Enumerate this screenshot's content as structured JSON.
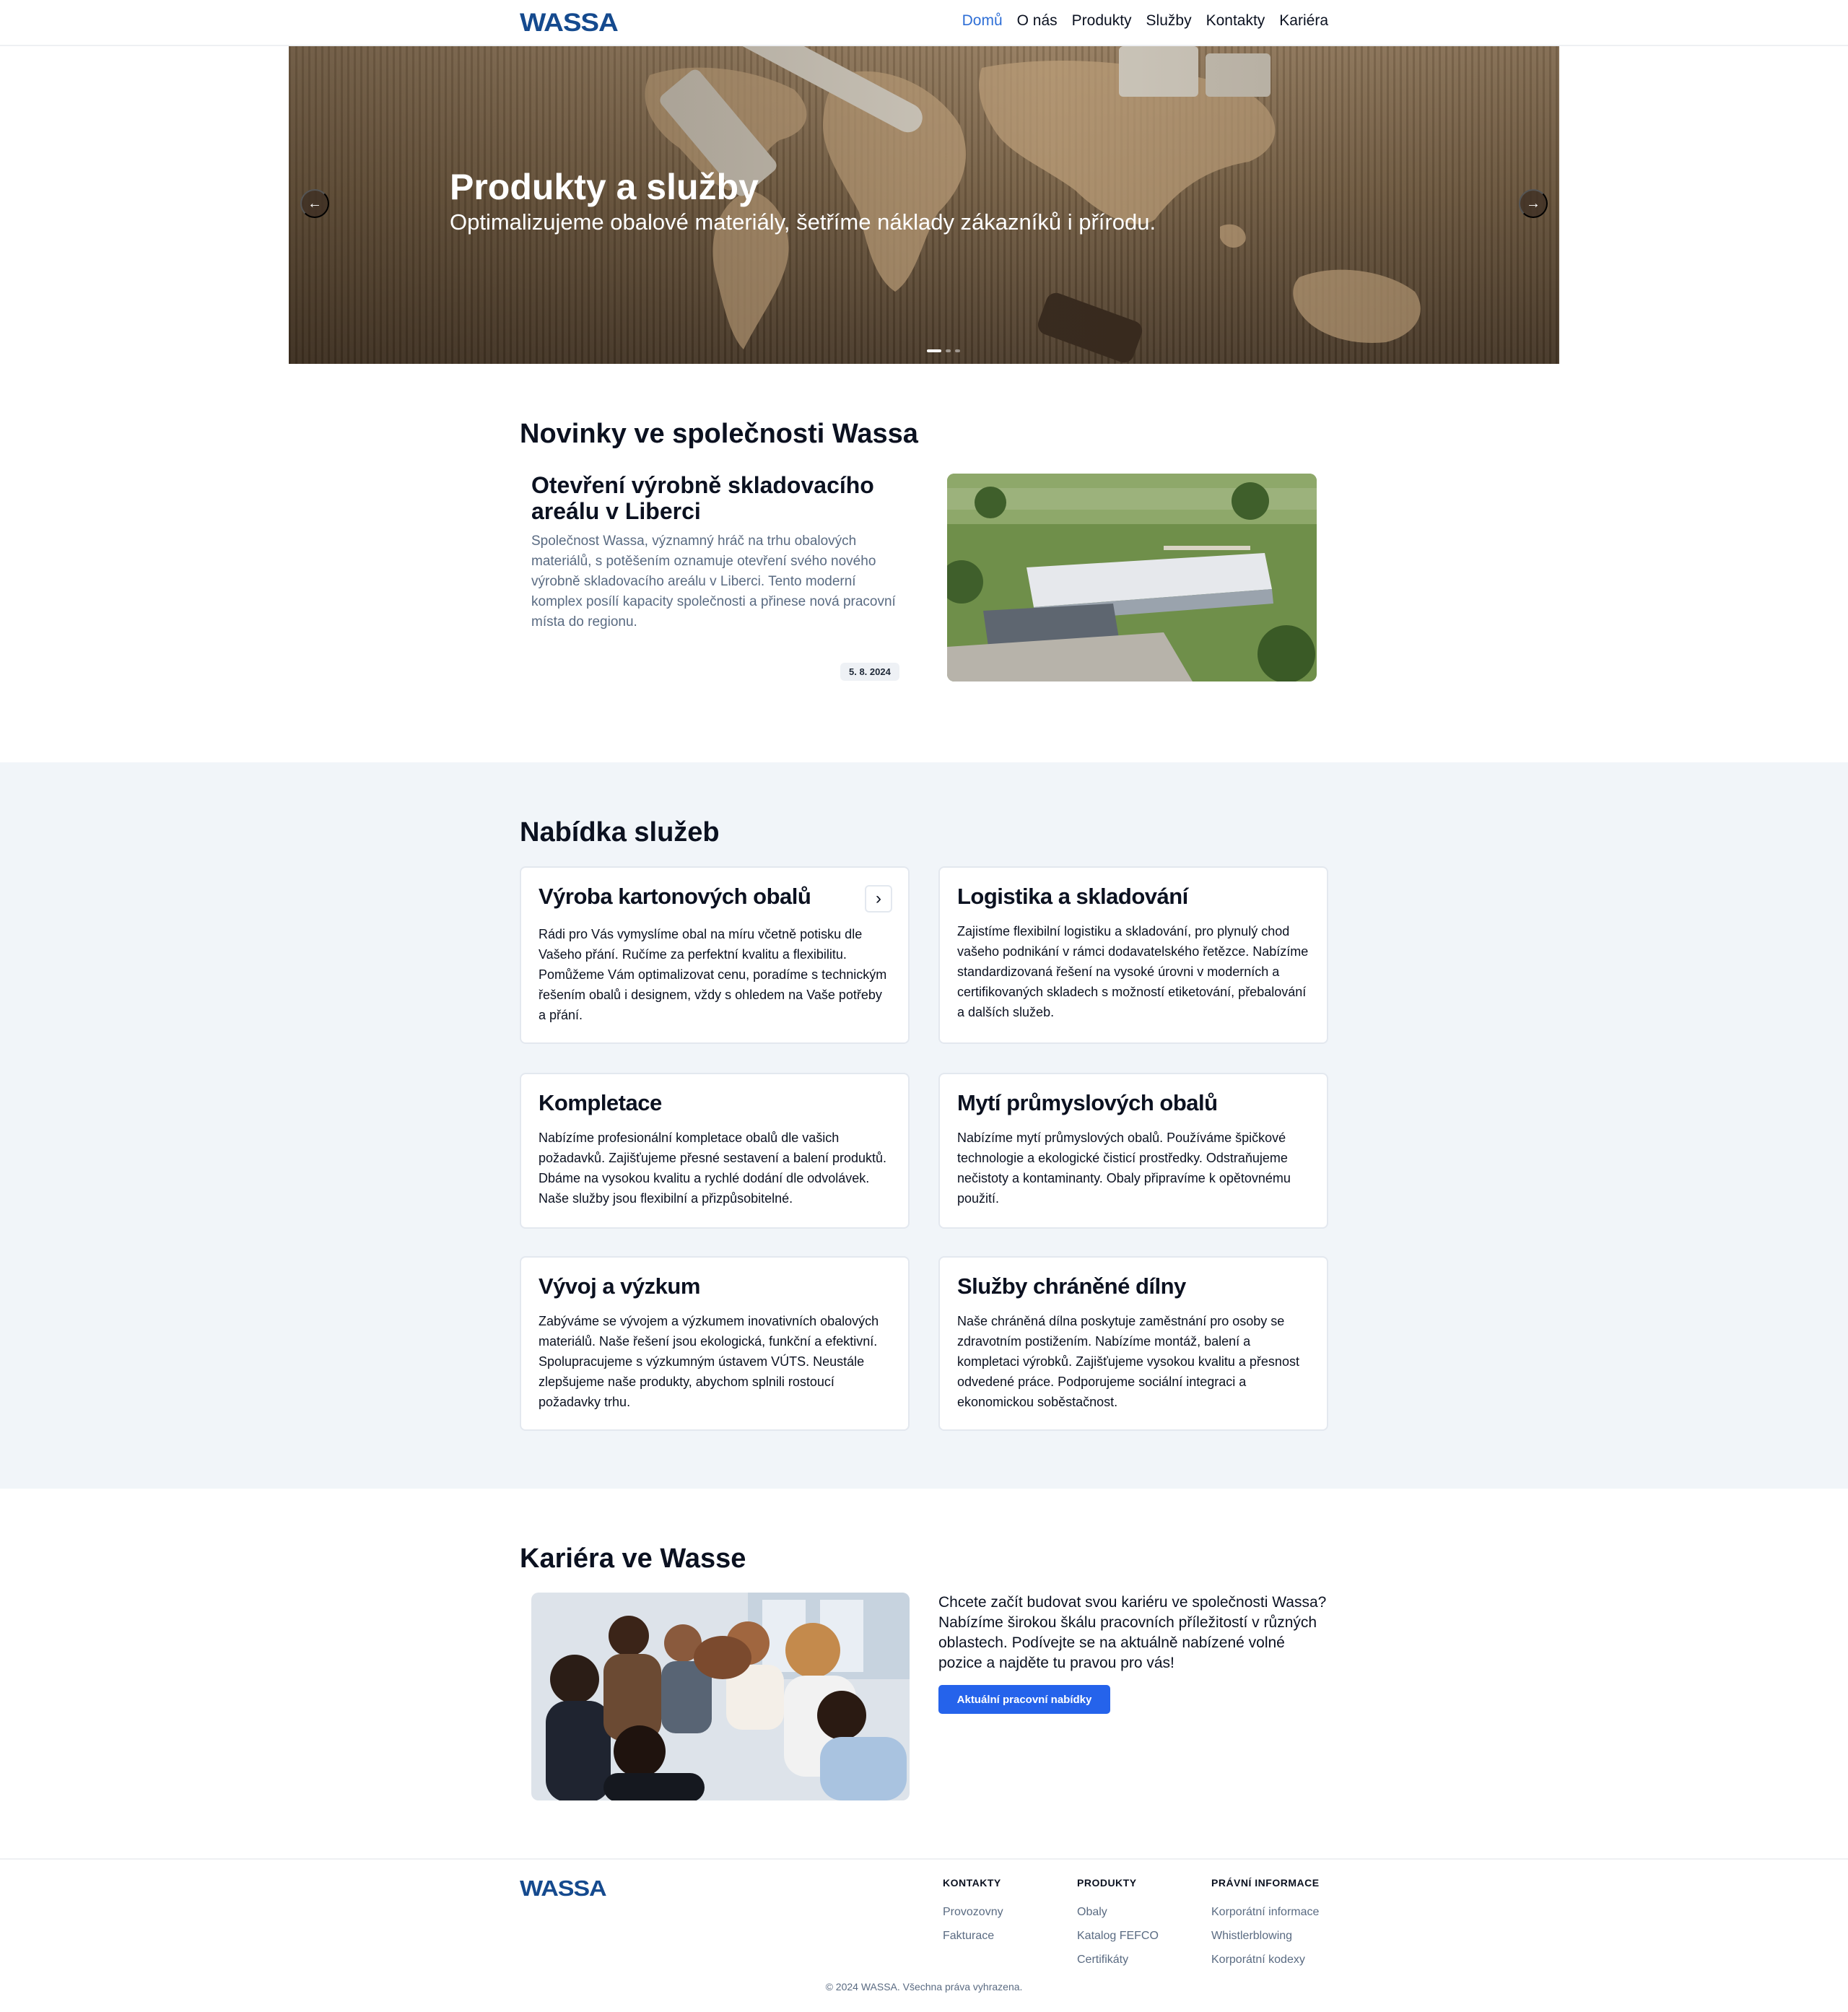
{
  "brand": {
    "logo_text": "WASSA",
    "accent": "#154a8e",
    "link_active": "#2f6fd6",
    "button": "#2563eb"
  },
  "nav": {
    "items": [
      {
        "label": "Domů",
        "active": true
      },
      {
        "label": "O nás"
      },
      {
        "label": "Produkty"
      },
      {
        "label": "Služby"
      },
      {
        "label": "Kontakty"
      },
      {
        "label": "Kariéra"
      }
    ]
  },
  "hero": {
    "title": "Produkty a služby",
    "subtitle": "Optimalizujeme obalové materiály, šetříme náklady zákazníků i přírodu.",
    "prev_icon": "arrow-left-icon",
    "next_icon": "arrow-right-icon",
    "slide_count": 3,
    "active_slide": 1
  },
  "news": {
    "heading": "Novinky ve společnosti Wassa",
    "title": "Otevření výrobně skladovacího areálu v Liberci",
    "text": "Společnost Wassa, významný hráč na trhu obalových materiálů, s potěšením oznamuje otevření svého nového výrobně skladovacího areálu v Liberci. Tento moderní komplex posílí kapacity společnosti a přinese nová pracovní místa do regionu.",
    "date": "5. 8. 2024"
  },
  "services": {
    "heading": "Nabídka služeb",
    "cards": [
      {
        "title": "Výroba kartonových obalů",
        "text": "Rádi pro Vás vymyslíme obal na míru včetně potisku dle Vašeho přání. Ručíme za perfektní kvalitu a flexibilitu. Pomůžeme Vám optimalizovat cenu, poradíme s technickým řešením obalů i designem, vždy s ohledem na Vaše potřeby a přání."
      },
      {
        "title": "Logistika a skladování",
        "text": "Zajistíme flexibilní logistiku a skladování, pro plynulý chod vašeho podnikání v rámci dodavatelského řetězce. Nabízíme standardizovaná řešení na vysoké úrovni v moderních a certifikovaných skladech s možností etiketování, přebalování a dalších služeb."
      },
      {
        "title": "Kompletace",
        "text": "Nabízíme profesionální kompletace obalů dle vašich požadavků. Zajišťujeme přesné sestavení a balení produktů. Dbáme na vysokou kvalitu a rychlé dodání dle odvolávek. Naše služby jsou flexibilní a přizpůsobitelné."
      },
      {
        "title": "Mytí průmyslových obalů",
        "text": "Nabízíme mytí průmyslových obalů. Používáme špičkové technologie a ekologické čisticí prostředky. Odstraňujeme nečistoty a kontaminanty. Obaly připravíme k opětovnému použití."
      },
      {
        "title": "Vývoj a výzkum",
        "text": "Zabýváme se vývojem a výzkumem inovativních obalových materiálů. Naše řešení jsou ekologická, funkční a efektivní. Spolupracujeme s výzkumným ústavem VÚTS. Neustále zlepšujeme naše produkty, abychom splnili rostoucí požadavky trhu."
      },
      {
        "title": "Služby chráněné dílny",
        "text": "Naše chráněná dílna poskytuje zaměstnání pro osoby se zdravotním postižením. Nabízíme montáž, balení a kompletaci výrobků. Zajišťujeme vysokou kvalitu a přesnost odvedené práce. Podporujeme sociální integraci a ekonomickou soběstačnost."
      }
    ],
    "card_arrow_icon": "chevron-right-icon"
  },
  "career": {
    "heading": "Kariéra ve Wasse",
    "text": "Chcete začít budovat svou kariéru ve společnosti Wassa? Nabízíme širokou škálu pracovních příležitostí v různých oblastech. Podívejte se na aktuálně nabízené volné pozice a najděte tu pravou pro vás!",
    "button": "Aktuální pracovní nabídky"
  },
  "footer": {
    "logo_text": "WASSA",
    "columns": [
      {
        "heading": "KONTAKTY",
        "links": [
          "Provozovny",
          "Fakturace"
        ]
      },
      {
        "heading": "PRODUKTY",
        "links": [
          "Obaly",
          "Katalog FEFCO",
          "Certifikáty"
        ]
      },
      {
        "heading": "PRÁVNÍ INFORMACE",
        "links": [
          "Korporátní informace",
          "Whistlerblowing",
          "Korporátní kodexy"
        ]
      }
    ],
    "copyright": "© 2024 WASSA. Všechna práva vyhrazena."
  }
}
